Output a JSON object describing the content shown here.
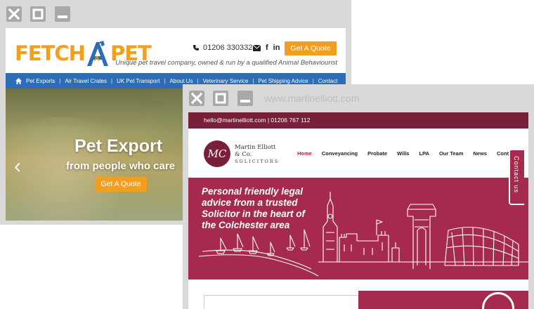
{
  "window1": {
    "logo": {
      "part1": "FETCH",
      "part2": "A",
      "part3": "PET"
    },
    "phone": "01206 330332",
    "phone_icon": "phone-icon",
    "social_icons": [
      "email-icon",
      "facebook-icon",
      "linkedin-icon"
    ],
    "quote_button": "Get A Quote",
    "tagline": "Unique pet travel company, owned & run by a qualified Animal Behaviourist",
    "nav": {
      "home_icon": "home-icon",
      "items": [
        "Pet Exports",
        "Air Travel Crates",
        "UK Pet Transport",
        "About Us",
        "Veterinary Service",
        "Pet Shipping Advice",
        "Contact"
      ]
    },
    "hero": {
      "title": "Pet Export",
      "subtitle": "from people who care",
      "button": "Get A Quote"
    },
    "colors": {
      "accent": "#f29f1f",
      "nav": "#2c6db5"
    }
  },
  "window2": {
    "background_title": "www.martinelliott.com",
    "topbar": "hello@martinelliott.com | 01206 767 112",
    "logo": {
      "initials": "MC",
      "line1": "Martin Elliott",
      "line2": "& Co.",
      "line3": "SOLICITORS"
    },
    "nav": [
      "Home",
      "Conveyancing",
      "Probate",
      "Wills",
      "LPA",
      "Our Team",
      "News",
      "Contact"
    ],
    "hero_lines": [
      "Personal friendly legal",
      "advice from a trusted",
      "Solicitor in the heart of",
      "the Colchester area"
    ],
    "contact_tab": "Contact us",
    "colors": {
      "primary": "#7a1f3a",
      "hero": "#a52a4d"
    }
  }
}
